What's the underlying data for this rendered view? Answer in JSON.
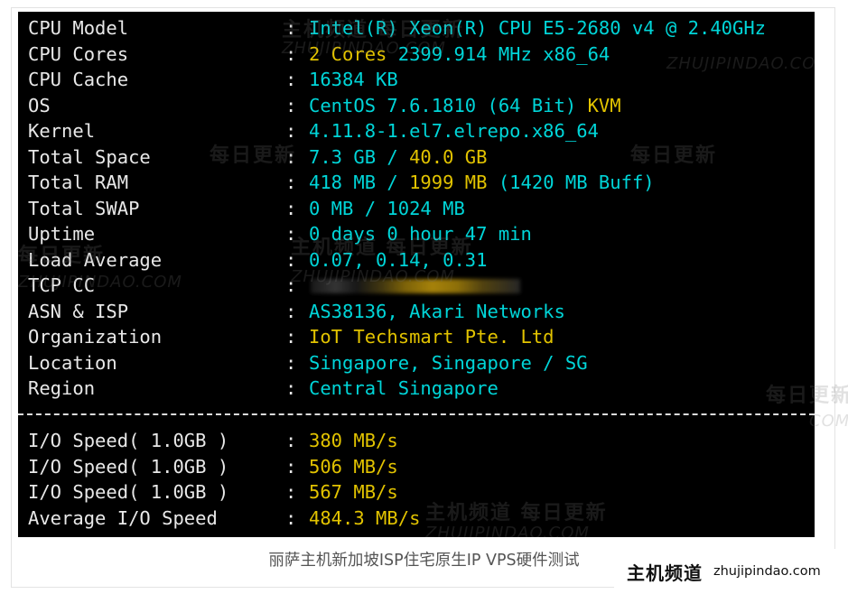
{
  "terminal": {
    "rows": [
      {
        "key": "CPU Model",
        "parts": [
          {
            "t": "Intel(R) Xeon(R) CPU E5-2680 v4 @ 2.40GHz",
            "c": "c"
          }
        ]
      },
      {
        "key": "CPU Cores",
        "parts": [
          {
            "t": "2 Cores ",
            "c": "y"
          },
          {
            "t": "2399.914 MHz x86_64",
            "c": "c"
          }
        ]
      },
      {
        "key": "CPU Cache",
        "parts": [
          {
            "t": "16384 KB",
            "c": "c"
          }
        ]
      },
      {
        "key": "OS",
        "parts": [
          {
            "t": "CentOS 7.6.1810 (64 Bit) ",
            "c": "c"
          },
          {
            "t": "KVM",
            "c": "y"
          }
        ]
      },
      {
        "key": "Kernel",
        "parts": [
          {
            "t": "4.11.8-1.el7.elrepo.x86_64",
            "c": "c"
          }
        ]
      },
      {
        "key": "Total Space",
        "parts": [
          {
            "t": "7.3 GB / ",
            "c": "c"
          },
          {
            "t": "40.0 GB",
            "c": "y"
          }
        ]
      },
      {
        "key": "Total RAM",
        "parts": [
          {
            "t": "418 MB / ",
            "c": "c"
          },
          {
            "t": "1999 MB ",
            "c": "y"
          },
          {
            "t": "(1420 MB Buff)",
            "c": "c"
          }
        ]
      },
      {
        "key": "Total SWAP",
        "parts": [
          {
            "t": "0 MB / 1024 MB",
            "c": "c"
          }
        ]
      },
      {
        "key": "Uptime",
        "parts": [
          {
            "t": "0 days 0 hour 47 min",
            "c": "c"
          }
        ]
      },
      {
        "key": "Load Average",
        "parts": [
          {
            "t": "0.07, 0.14, 0.31",
            "c": "c"
          }
        ]
      },
      {
        "key": "TCP CC",
        "parts": [],
        "redacted": true
      },
      {
        "key": "ASN & ISP",
        "parts": [
          {
            "t": "AS38136, Akari Networks",
            "c": "c"
          }
        ]
      },
      {
        "key": "Organization",
        "parts": [
          {
            "t": "IoT Techsmart Pte. Ltd",
            "c": "y"
          }
        ]
      },
      {
        "key": "Location",
        "parts": [
          {
            "t": "Singapore, Singapore / SG",
            "c": "c"
          }
        ]
      },
      {
        "key": "Region",
        "parts": [
          {
            "t": "Central Singapore",
            "c": "c"
          }
        ]
      }
    ],
    "io_rows": [
      {
        "key": "I/O Speed( 1.0GB )",
        "parts": [
          {
            "t": "380 MB/s",
            "c": "y"
          }
        ]
      },
      {
        "key": "I/O Speed( 1.0GB )",
        "parts": [
          {
            "t": "506 MB/s",
            "c": "y"
          }
        ]
      },
      {
        "key": "I/O Speed( 1.0GB )",
        "parts": [
          {
            "t": "567 MB/s",
            "c": "y"
          }
        ]
      },
      {
        "key": "Average I/O Speed",
        "parts": [
          {
            "t": "484.3 MB/s",
            "c": "y"
          }
        ]
      }
    ],
    "colon": ":",
    "colors": {
      "cyan": "#00d5d8",
      "yellow": "#e2c300",
      "white": "#e8e8e8",
      "background": "#000000"
    }
  },
  "watermarks": {
    "cn": "主机频道 每日更新",
    "cn_short": "每日更新",
    "url": "ZHUJIPINDAO.COM",
    "url_short": "COM"
  },
  "caption": "丽萨主机新加坡ISP住宅原生IP VPS硬件测试",
  "brand": {
    "cn": "主机频道",
    "url": "zhujipindao.com"
  }
}
